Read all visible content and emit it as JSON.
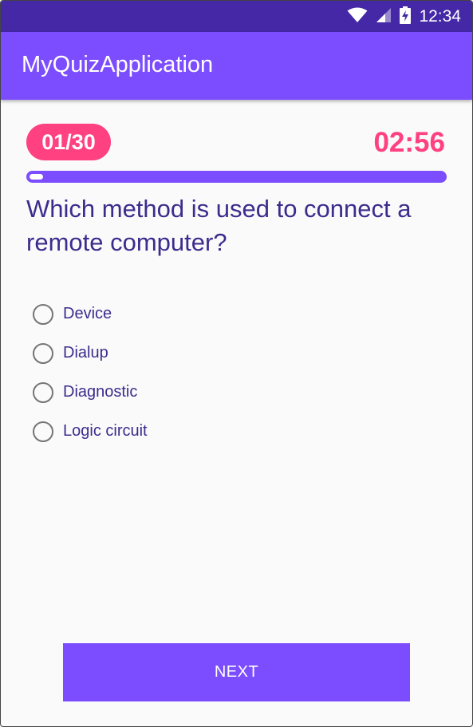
{
  "status_bar": {
    "time": "12:34",
    "icons": [
      "wifi-icon",
      "cell-signal-icon",
      "battery-charging-icon"
    ]
  },
  "app_bar": {
    "title": "MyQuizApplication"
  },
  "quiz": {
    "counter": "01/30",
    "timer": "02:56",
    "progress_fraction": 0.033,
    "question": "Which method is used to connect a remote computer?",
    "options": [
      {
        "label": "Device",
        "selected": false
      },
      {
        "label": "Dialup",
        "selected": false
      },
      {
        "label": "Diagnostic",
        "selected": false
      },
      {
        "label": "Logic circuit",
        "selected": false
      }
    ],
    "next_label": "NEXT"
  },
  "colors": {
    "status_bar": "#4528a6",
    "primary": "#7c4dff",
    "accent": "#ff4081",
    "text": "#3d2c8d"
  }
}
